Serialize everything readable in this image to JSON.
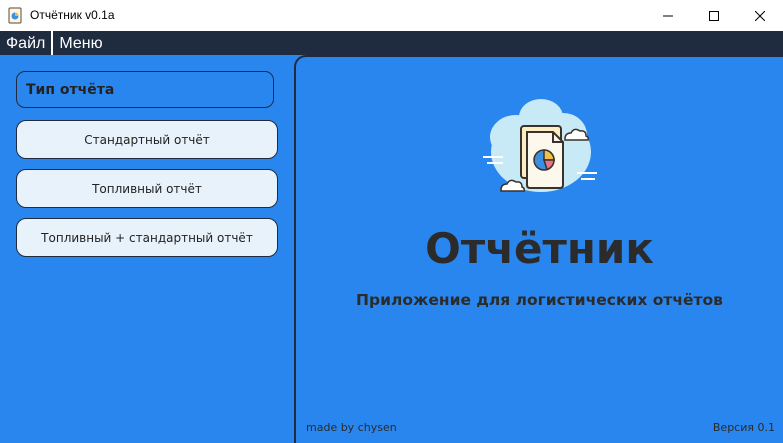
{
  "window": {
    "title": "Отчётник v0.1a"
  },
  "menubar": {
    "items": [
      {
        "label": "Файл"
      },
      {
        "label": "Меню"
      }
    ]
  },
  "sidebar": {
    "header": "Тип отчёта",
    "buttons": [
      {
        "label": "Стандартный отчёт"
      },
      {
        "label": "Топливный отчёт"
      },
      {
        "label": "Топливный + стандартный отчёт"
      }
    ]
  },
  "main": {
    "app_name": "Отчётник",
    "subtitle": "Приложение для логистических отчётов",
    "credit": "made by chysen",
    "version": "Версия 0.1",
    "illustration_icon": "report-chart-cloud-icon"
  },
  "colors": {
    "background": "#2a86ef",
    "menubar": "#1f2c40",
    "button_fill": "#e8f2fb",
    "text_dark": "#2b2b2b"
  }
}
